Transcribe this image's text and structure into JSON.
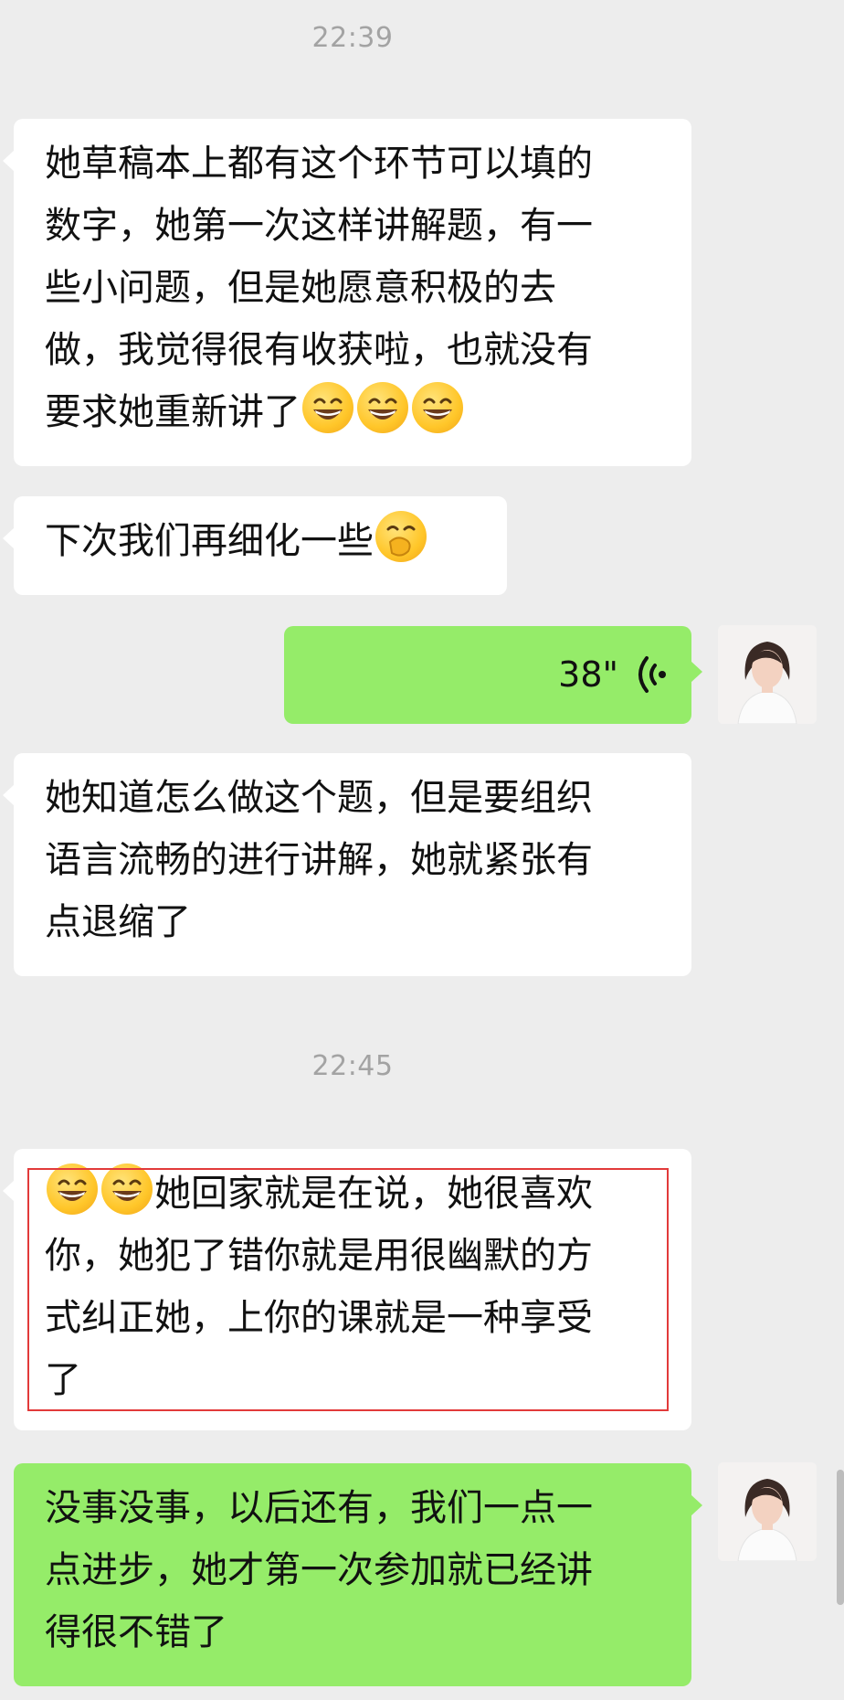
{
  "timestamps": [
    "22:39",
    "22:45"
  ],
  "messages": {
    "m1": {
      "line1": "她草稿本上都有这个环节可以填的",
      "line2": "数字，她第一次这样讲解题，有一",
      "line3": "些小问题，但是她愿意积极的去",
      "line4": "做，我觉得很有收获啦，也就没有",
      "line5": "要求她重新讲了",
      "emoji": "grinning-face"
    },
    "m2": {
      "text": "下次我们再细化一些",
      "emoji": "face-with-hand-over-mouth"
    },
    "voice": {
      "duration": "38\""
    },
    "m4": {
      "line1": "她知道怎么做这个题，但是要组织",
      "line2": "语言流畅的进行讲解，她就紧张有",
      "line3": "点退缩了"
    },
    "m5": {
      "line1": "她回家就是在说，她很喜欢",
      "line2": "你，她犯了错你就是用很幽默的方",
      "line3": "式纠正她，上你的课就是一种享受",
      "line4": "了",
      "emoji": "grinning-face"
    },
    "m6": {
      "line1": "没事没事，以后还有，我们一点一",
      "line2": "点进步，她才第一次参加就已经讲",
      "line3": "得很不错了"
    }
  },
  "colors": {
    "background": "#ededed",
    "incoming_bubble": "#ffffff",
    "outgoing_bubble": "#95ec69",
    "timestamp": "#a3a3a3",
    "highlight_border": "#e23a3a"
  }
}
